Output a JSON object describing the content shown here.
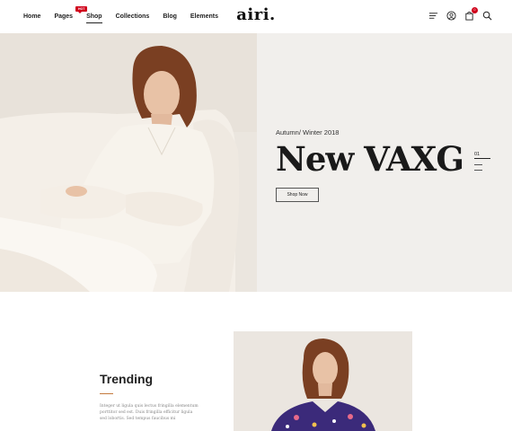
{
  "nav": {
    "items": [
      {
        "label": "Home"
      },
      {
        "label": "Pages"
      },
      {
        "label": "Shop",
        "active": true,
        "badge": "HOT"
      },
      {
        "label": "Collections"
      },
      {
        "label": "Blog"
      },
      {
        "label": "Elements"
      }
    ]
  },
  "logo": "airi.",
  "header_icons": [
    {
      "name": "menu-icon"
    },
    {
      "name": "user-icon"
    },
    {
      "name": "bag-icon",
      "count": "0"
    },
    {
      "name": "search-icon"
    }
  ],
  "hero": {
    "subtitle": "Autumn/ Winter 2018",
    "title": "New VAXG",
    "button_label": "Shop Now",
    "slide_number": "01"
  },
  "trending": {
    "title": "Trending",
    "description": "Integer ut ligula quis lectus fringilla elementum porttitor sed est. Duis fringilla efficitur ligula sed lobortis. Sed tempus faucibus mi"
  },
  "colors": {
    "accent": "#d0021b",
    "hero_bg": "#f1efec",
    "rule": "#c47a3e"
  }
}
